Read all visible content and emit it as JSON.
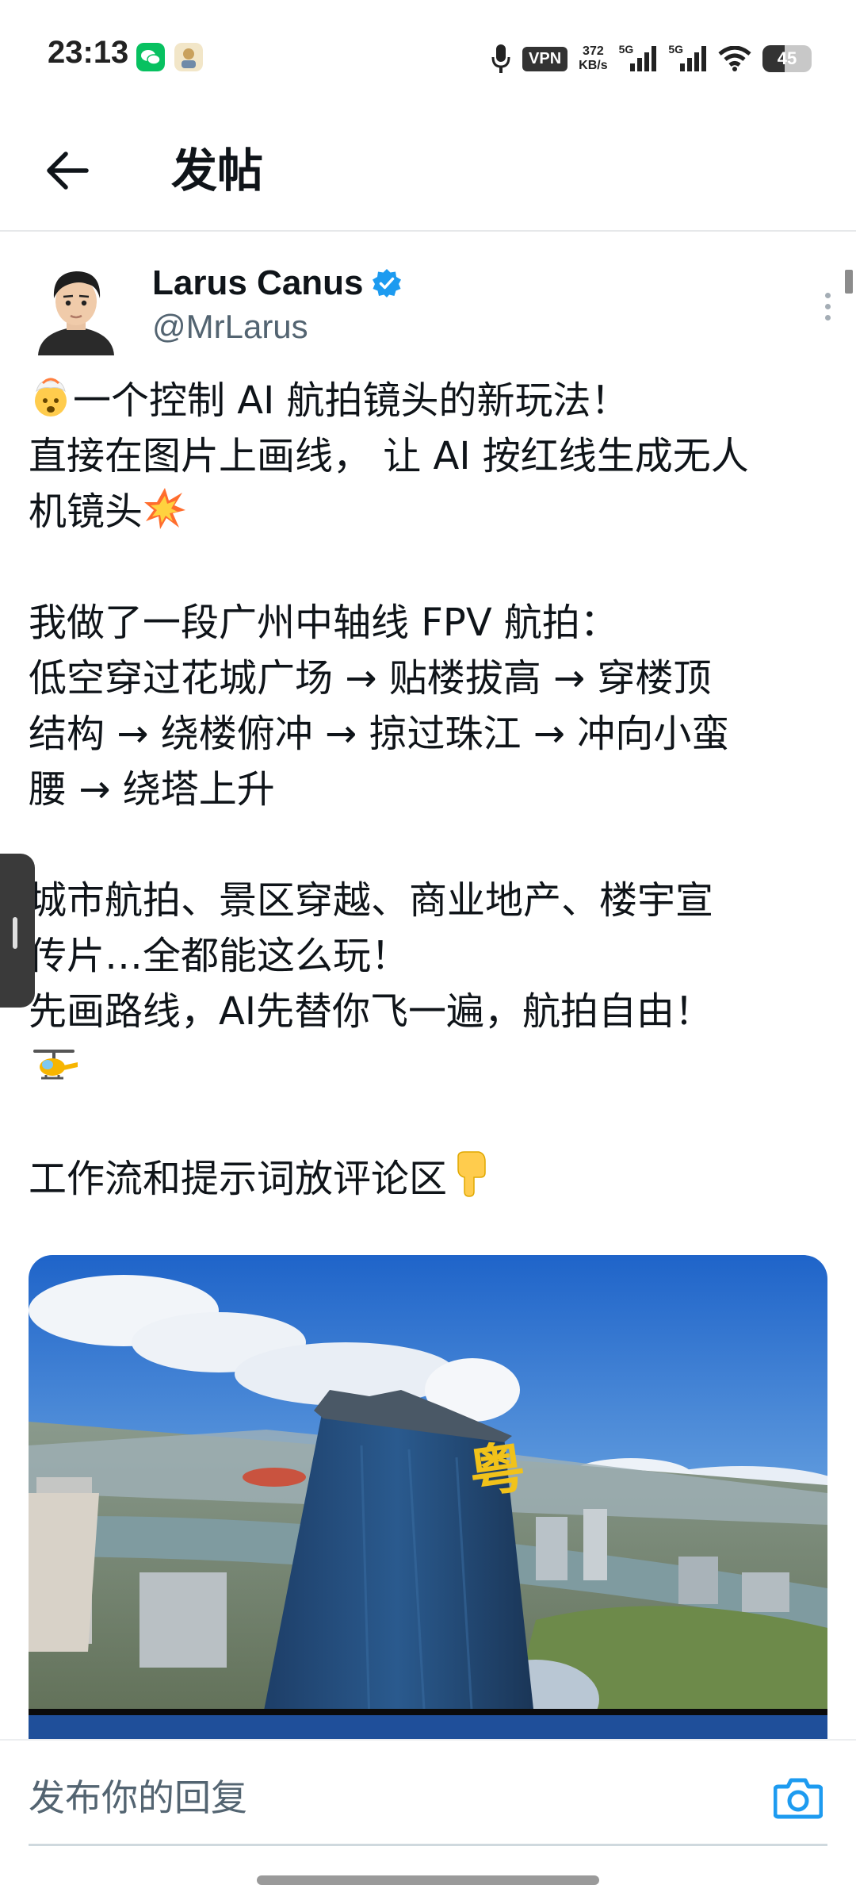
{
  "status_bar": {
    "time": "23:13",
    "vpn": "VPN",
    "speed_value": "372",
    "speed_unit": "KB/s",
    "network_1": "5G",
    "network_2": "5G",
    "battery_level": "45",
    "battery_fraction": 0.45,
    "icons": [
      "wechat-icon",
      "app-notification-icon",
      "microphone-icon",
      "signal-icon",
      "wifi-icon",
      "battery-icon"
    ]
  },
  "header": {
    "back_icon": "arrow-left-icon",
    "title": "发帖"
  },
  "tweet": {
    "author_name": "Larus Canus",
    "verified_icon": "verified-badge-icon",
    "author_handle": "@MrLarus",
    "more_icon": "more-vertical-icon",
    "lines": {
      "l1": "一个控制 AI 航拍镜头的新玩法！",
      "l2": "直接在图片上画线， 让 AI 按红线生成无人",
      "l3": "机镜头",
      "l4": "我做了一段广州中轴线 FPV 航拍：",
      "l5": "低空穿过花城广场 → 贴楼拔高 → 穿楼顶",
      "l6": "结构 → 绕楼俯冲 → 掠过珠江 → 冲向小蛮",
      "l7": "腰 → 绕塔上升",
      "l8": "城市航拍、景区穿越、商业地产、楼宇宣",
      "l9": "传片…全都能这么玩！",
      "l10": "先画路线，AI先替你飞一遍，航拍自由！",
      "l12": "工作流和提示词放评论区"
    },
    "emojis": [
      "exploding-head-emoji",
      "collision-emoji",
      "helicopter-emoji",
      "pointing-down-emoji"
    ],
    "media": {
      "description_icon": "video-thumbnail-image",
      "building_sign": "粤"
    }
  },
  "reply": {
    "placeholder": "发布你的回复",
    "camera_icon": "camera-icon"
  },
  "colors": {
    "accent": "#1d9bf0",
    "text": "#0f1419",
    "secondary": "#536471"
  }
}
